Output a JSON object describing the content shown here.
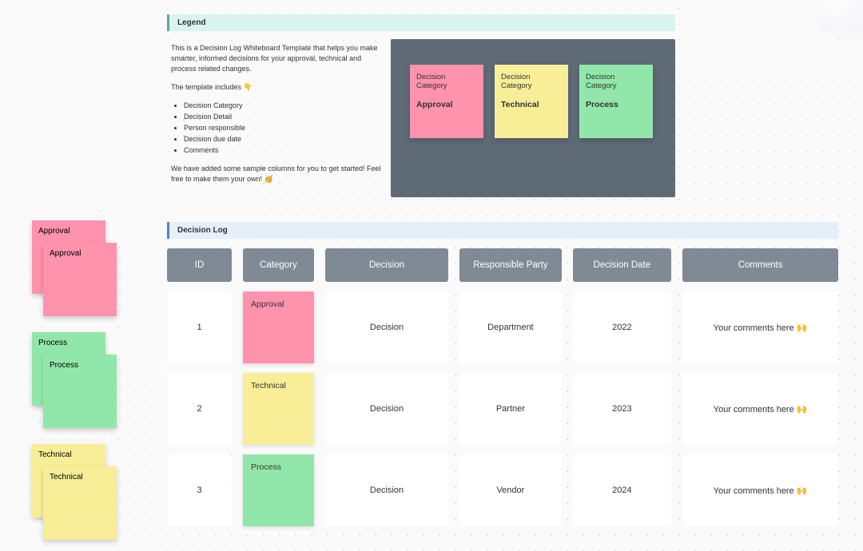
{
  "legend": {
    "title": "Legend",
    "para1": "This is a Decision Log Whiteboard Template that helps you make smarter, informed decisions for your approval, technical and process related changes.",
    "para2_prefix": "The template includes ",
    "para2_emoji": "👇",
    "bullets": [
      "Decision Category",
      "Decision Detail",
      "Person responsible",
      "Decision due date",
      "Comments"
    ],
    "para3": "We have added some sample columns for you to get started! Feel free to make them your own! 🥳",
    "cat_label": "Decision Category",
    "cats": [
      "Approval",
      "Technical",
      "Process"
    ]
  },
  "stacks": {
    "approval": "Approval",
    "process": "Process",
    "technical": "Technical"
  },
  "dlog": {
    "title": "Decision Log",
    "headers": {
      "id": "ID",
      "category": "Category",
      "decision": "Decision",
      "responsible": "Responsible Party",
      "date": "Decision Date",
      "comments": "Comments"
    },
    "rows": [
      {
        "id": "1",
        "category": "Approval",
        "cat_color": "pink",
        "decision": "Decision",
        "responsible": "Department",
        "date": "2022",
        "comments": "Your comments here 🙌"
      },
      {
        "id": "2",
        "category": "Technical",
        "cat_color": "yellow",
        "decision": "Decision",
        "responsible": "Partner",
        "date": "2023",
        "comments": "Your comments here 🙌"
      },
      {
        "id": "3",
        "category": "Process",
        "cat_color": "green",
        "decision": "Decision",
        "responsible": "Vendor",
        "date": "2024",
        "comments": "Your comments here 🙌"
      }
    ]
  }
}
